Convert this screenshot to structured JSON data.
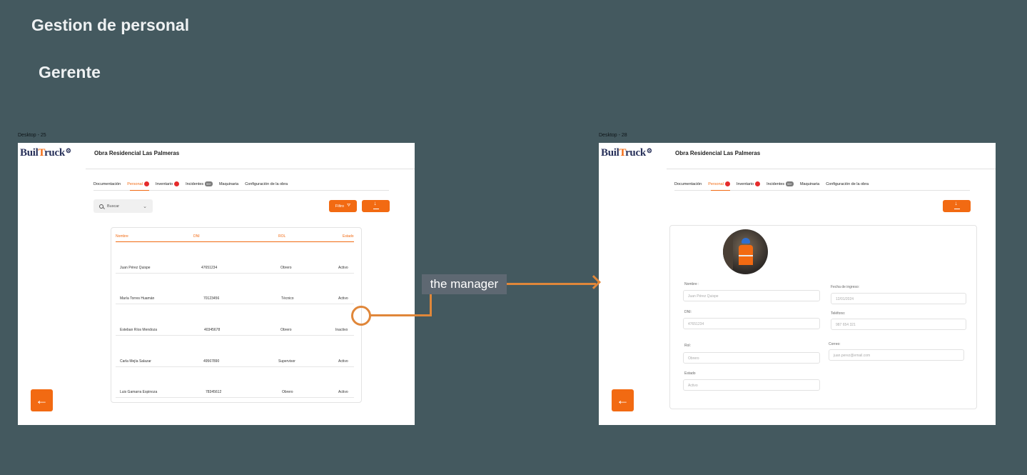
{
  "canvas": {
    "title": "Gestion de personal",
    "subtitle": "Gerente",
    "frame_left_label": "Desktop - 25",
    "frame_right_label": "Desktop - 28",
    "annotation": "the manager"
  },
  "brand": {
    "logo_prefix": "Buil",
    "logo_t": "T",
    "logo_suffix": "ruck",
    "logo_gear": "⚙"
  },
  "app": {
    "project_title": "Obra Residencial Las Palmeras",
    "tabs": [
      {
        "label": "Documentación",
        "badge": ""
      },
      {
        "label": "Personal",
        "badge": "red"
      },
      {
        "label": "Inventario",
        "badge": "red"
      },
      {
        "label": "Incidentes",
        "badge": "99+"
      },
      {
        "label": "Maquinaria",
        "badge": ""
      },
      {
        "label": "Configuración de la obra",
        "badge": ""
      }
    ],
    "active_tab": "Personal",
    "search_placeholder": "Buscar",
    "filter_label": "Filtro",
    "accent_color": "#f26a12",
    "icons": {
      "download": "download-icon",
      "back": "arrow-left-icon",
      "filter": "filter-icon",
      "search": "search-icon"
    }
  },
  "table": {
    "headers": [
      "Nombre",
      "DNI",
      "ROL",
      "Estado"
    ],
    "rows": [
      [
        "Juan Pérez Quispe",
        "47651234",
        "Obrero",
        "Activo"
      ],
      [
        "María Torres Huamán",
        "70123456",
        "Técnico",
        "Activo"
      ],
      [
        "Esteban Ríos Mendoza",
        "40345678",
        "Obrero",
        "Inactivo"
      ],
      [
        "Carla Mejía Salazar",
        "49567890",
        "Supervisor",
        "Activo"
      ],
      [
        "Luis Gamarra Espinoza",
        "78345612",
        "Obrero",
        "Activo"
      ]
    ]
  },
  "detail": {
    "nombre_label": "Nombre :",
    "nombre_value": "Juan Pérez Quispe",
    "fecha_label": "Fecha de ingreso:",
    "fecha_value": "12/01/2024",
    "dni_label": "DNI:",
    "dni_value": "47651234",
    "telefono_label": "Teléfono:",
    "telefono_value": "987 654 321",
    "rol_label": "Rol:",
    "rol_value": "Obrero",
    "correo_label": "Correo:",
    "correo_value": "juan.perez@email.com",
    "estado_label": "Estado",
    "estado_value": "Activo"
  }
}
